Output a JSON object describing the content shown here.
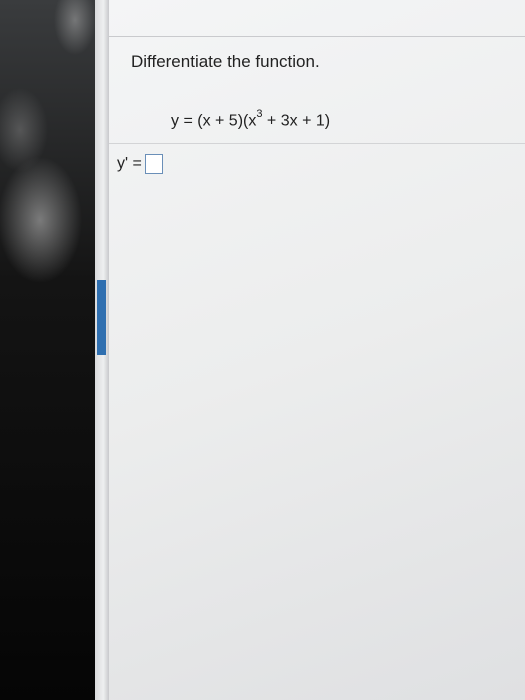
{
  "question": {
    "prompt": "Differentiate the function."
  },
  "equation": {
    "lhs": "y = (x + 5)(x",
    "exponent": "3",
    "rest": " + 3x + 1)"
  },
  "answer": {
    "label": "y' =",
    "value": ""
  },
  "colors": {
    "accent": "#2f6fb0",
    "answer_box_border": "#6a8fb8"
  }
}
